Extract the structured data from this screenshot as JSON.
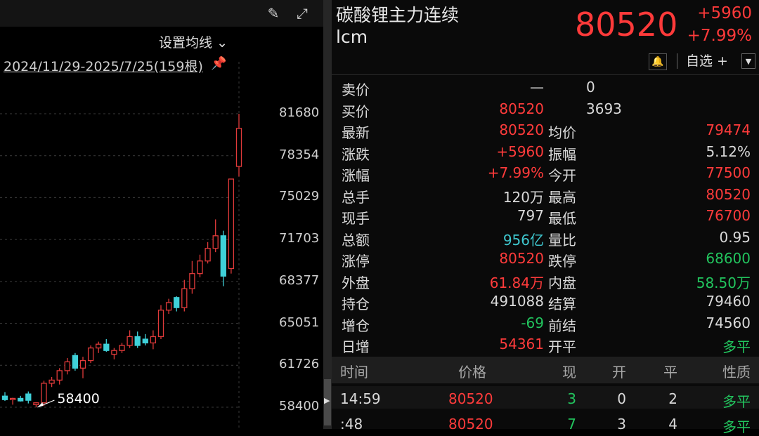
{
  "chart": {
    "ma_setting": "设置均线",
    "range_label": "2024/11/29-2025/7/25(159根)",
    "low_annotation": "58400",
    "price_ticks": [
      "81680",
      "78354",
      "75029",
      "71703",
      "68377",
      "65051",
      "61726",
      "58400"
    ],
    "colors": {
      "up": "#e03a3a",
      "down": "#3fd0d8"
    },
    "candles": [
      {
        "o": 59280,
        "h": 59600,
        "l": 58900,
        "c": 59000
      },
      {
        "o": 59000,
        "h": 59150,
        "l": 58600,
        "c": 59100
      },
      {
        "o": 59100,
        "h": 59300,
        "l": 58850,
        "c": 58900
      },
      {
        "o": 59450,
        "h": 59650,
        "l": 58700,
        "c": 58950
      },
      {
        "o": 58600,
        "h": 58800,
        "l": 58400,
        "c": 58750
      },
      {
        "o": 58750,
        "h": 60500,
        "l": 58500,
        "c": 60300
      },
      {
        "o": 60300,
        "h": 60800,
        "l": 60000,
        "c": 60550
      },
      {
        "o": 60550,
        "h": 61500,
        "l": 60200,
        "c": 61300
      },
      {
        "o": 61300,
        "h": 62300,
        "l": 61000,
        "c": 62000
      },
      {
        "o": 62500,
        "h": 62700,
        "l": 61300,
        "c": 61500
      },
      {
        "o": 61500,
        "h": 62400,
        "l": 60700,
        "c": 62100
      },
      {
        "o": 62100,
        "h": 63300,
        "l": 61900,
        "c": 63100
      },
      {
        "o": 63100,
        "h": 63600,
        "l": 62700,
        "c": 63400
      },
      {
        "o": 63400,
        "h": 63800,
        "l": 62800,
        "c": 62900
      },
      {
        "o": 62600,
        "h": 63100,
        "l": 62200,
        "c": 62900
      },
      {
        "o": 62900,
        "h": 63500,
        "l": 62700,
        "c": 63300
      },
      {
        "o": 63300,
        "h": 64500,
        "l": 63100,
        "c": 64000
      },
      {
        "o": 64000,
        "h": 64400,
        "l": 63100,
        "c": 63300
      },
      {
        "o": 63800,
        "h": 64200,
        "l": 63300,
        "c": 63500
      },
      {
        "o": 63500,
        "h": 64500,
        "l": 63000,
        "c": 64000
      },
      {
        "o": 64000,
        "h": 66500,
        "l": 63800,
        "c": 66100
      },
      {
        "o": 66100,
        "h": 67000,
        "l": 65800,
        "c": 66700
      },
      {
        "o": 67100,
        "h": 67200,
        "l": 66000,
        "c": 66300
      },
      {
        "o": 66300,
        "h": 68500,
        "l": 66000,
        "c": 67800
      },
      {
        "o": 67800,
        "h": 70000,
        "l": 67400,
        "c": 69000
      },
      {
        "o": 69000,
        "h": 70500,
        "l": 68700,
        "c": 70000
      },
      {
        "o": 70000,
        "h": 71500,
        "l": 69800,
        "c": 71000
      },
      {
        "o": 71000,
        "h": 73300,
        "l": 70700,
        "c": 72000
      },
      {
        "o": 72000,
        "h": 72400,
        "l": 68000,
        "c": 68800
      },
      {
        "o": 69400,
        "h": 75200,
        "l": 69000,
        "c": 76500
      },
      {
        "o": 77500,
        "h": 81680,
        "l": 76700,
        "c": 80520
      }
    ]
  },
  "quote": {
    "name": "碳酸锂主力连续",
    "code": "lcm",
    "last": "80520",
    "change": "+5960",
    "change_pct": "+7.99%",
    "watchlist_label": "自选 +",
    "rows": [
      {
        "l1": "卖价",
        "v1": "—",
        "v1c": "white",
        "v2": "0",
        "v2c": "white",
        "offer": true
      },
      {
        "l1": "买价",
        "v1": "80520",
        "v1c": "red",
        "v2": "3693",
        "v2c": "white",
        "offer": true
      },
      {
        "l1": "最新",
        "v1": "80520",
        "v1c": "red",
        "l2": "均价",
        "v2": "79474",
        "v2c": "red"
      },
      {
        "l1": "涨跌",
        "v1": "+5960",
        "v1c": "red",
        "l2": "振幅",
        "v2": "5.12%",
        "v2c": "white"
      },
      {
        "l1": "涨幅",
        "v1": "+7.99%",
        "v1c": "red",
        "l2": "今开",
        "v2": "77500",
        "v2c": "red"
      },
      {
        "l1": "总手",
        "v1": "120万",
        "v1c": "white",
        "l2": "最高",
        "v2": "80520",
        "v2c": "red"
      },
      {
        "l1": "现手",
        "v1": "797",
        "v1c": "white",
        "l2": "最低",
        "v2": "76700",
        "v2c": "red"
      },
      {
        "l1": "总额",
        "v1": "956亿",
        "v1c": "cyan",
        "l2": "量比",
        "v2": "0.95",
        "v2c": "white"
      },
      {
        "l1": "涨停",
        "v1": "80520",
        "v1c": "red",
        "l2": "跌停",
        "v2": "68600",
        "v2c": "green"
      },
      {
        "l1": "外盘",
        "v1": "61.84万",
        "v1c": "red",
        "l2": "内盘",
        "v2": "58.50万",
        "v2c": "green"
      },
      {
        "l1": "持仓",
        "v1": "491088",
        "v1c": "white",
        "l2": "结算",
        "v2": "79460",
        "v2c": "white"
      },
      {
        "l1": "增仓",
        "v1": "-69",
        "v1c": "green",
        "l2": "前结",
        "v2": "74560",
        "v2c": "white"
      },
      {
        "l1": "日增",
        "v1": "54361",
        "v1c": "red",
        "l2": "开平",
        "v2": "多平",
        "v2c": "green"
      }
    ],
    "trade_headers": {
      "time": "时间",
      "price": "价格",
      "now": "现",
      "open": "开",
      "close": "平",
      "nature": "性质"
    },
    "trades": [
      {
        "time": "14:59",
        "price": "80520",
        "now": "3",
        "open": "0",
        "close": "2",
        "nature": "多平"
      },
      {
        "time": ":48",
        "price": "80520",
        "now": "7",
        "open": "3",
        "close": "4",
        "nature": "多平"
      }
    ]
  }
}
